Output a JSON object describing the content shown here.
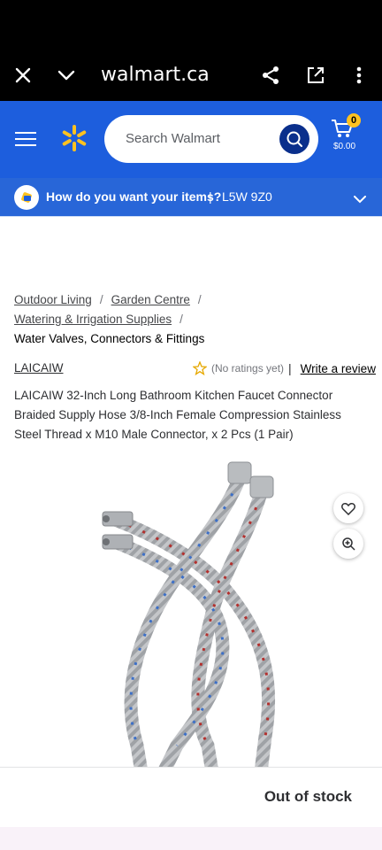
{
  "browser": {
    "url": "walmart.ca",
    "close_icon": "close-icon",
    "chevron_icon": "chevron-down-icon",
    "share_icon": "share-icon",
    "open_external_icon": "open-external-icon",
    "menu_icon": "more-vertical-icon"
  },
  "header": {
    "search_placeholder": "Search Walmart",
    "cart_count": "0",
    "cart_total": "$0.00",
    "brand_color": "#1d5edd",
    "spark_color": "#ffc220"
  },
  "delivery": {
    "question": "How do you want your items?",
    "separator": "|",
    "postal_code": "L5W 9Z0"
  },
  "breadcrumb": {
    "items": [
      "Outdoor Living",
      "Garden Centre",
      "Watering & Irrigation Supplies"
    ],
    "current": "Water Valves, Connectors & Fittings"
  },
  "product": {
    "brand": "LAICAIW",
    "ratings_text": "(No ratings yet)",
    "separator": "|",
    "review_link": "Write a review",
    "title": "LAICAIW 32-Inch Long Bathroom Kitchen Faucet Connector Braided Supply Hose 3/8-Inch Female Compression Stainless Steel Thread x M10 Male Connector, x 2 Pcs (1 Pair)"
  },
  "footer": {
    "status": "Out of stock"
  }
}
